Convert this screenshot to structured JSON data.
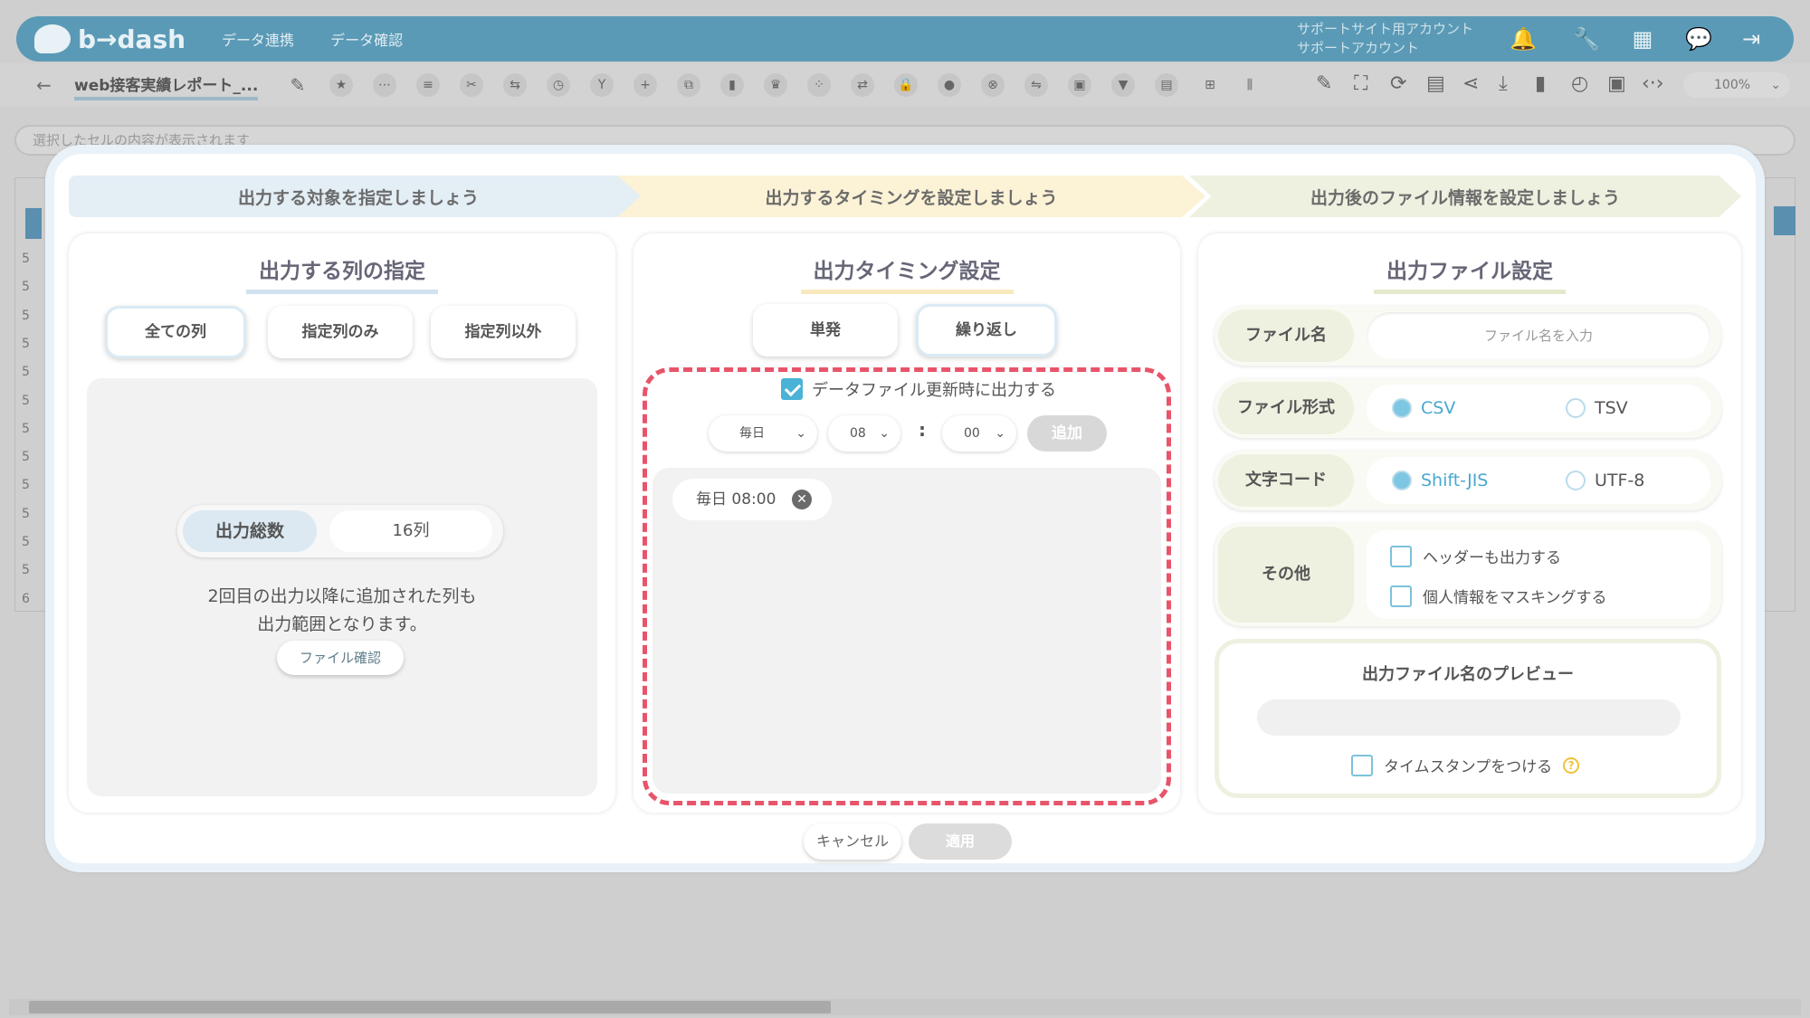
{
  "app": {
    "logo_text": "b→dash",
    "nav": [
      "データ連携",
      "データ確認"
    ],
    "account_line1": "サポートサイト用アカウント",
    "account_line2": "サポートアカウント"
  },
  "toolbar": {
    "report_title": "web接客実績レポート_...",
    "zoom": "100%"
  },
  "cell_bar": {
    "placeholder": "選択したセルの内容が表示されます"
  },
  "grid": {
    "row_numbers": [
      "5",
      "5",
      "5",
      "5",
      "5",
      "5",
      "5",
      "5",
      "5",
      "5",
      "5",
      "5",
      "6"
    ]
  },
  "steps": {
    "step1": "出力する対象を指定しましょう",
    "step2": "出力するタイミングを設定しましょう",
    "step3": "出力後のファイル情報を設定しましょう"
  },
  "columns_panel": {
    "title": "出力する列の指定",
    "buttons": [
      "全ての列",
      "指定列のみ",
      "指定列以外"
    ],
    "active_index": 0,
    "count_label": "出力総数",
    "count_value": "16列",
    "note_line1": "2回目の出力以降に追加された列も",
    "note_line2": "出力範囲となります。",
    "file_check": "ファイル確認"
  },
  "timing_panel": {
    "title": "出力タイミング設定",
    "buttons": [
      "単発",
      "繰り返し"
    ],
    "active_index": 1,
    "update_checkbox_label": "データファイル更新時に出力する",
    "update_checkbox_checked": true,
    "frequency": "毎日",
    "hour": "08",
    "colon": ":",
    "minute": "00",
    "add_label": "追加",
    "schedules": [
      "毎日 08:00"
    ]
  },
  "file_panel": {
    "title": "出力ファイル設定",
    "filename_label": "ファイル名",
    "filename_placeholder": "ファイル名を入力",
    "format_label": "ファイル形式",
    "format_options": [
      "CSV",
      "TSV"
    ],
    "format_selected": "CSV",
    "encoding_label": "文字コード",
    "encoding_options": [
      "Shift-JIS",
      "UTF-8"
    ],
    "encoding_selected": "Shift-JIS",
    "other_label": "その他",
    "header_label": "ヘッダーも出力する",
    "mask_label": "個人情報をマスキングする",
    "preview_title": "出力ファイル名のプレビュー",
    "timestamp_label": "タイムスタンプをつける",
    "help": "?"
  },
  "footer": {
    "cancel": "キャンセル",
    "apply": "適用"
  }
}
